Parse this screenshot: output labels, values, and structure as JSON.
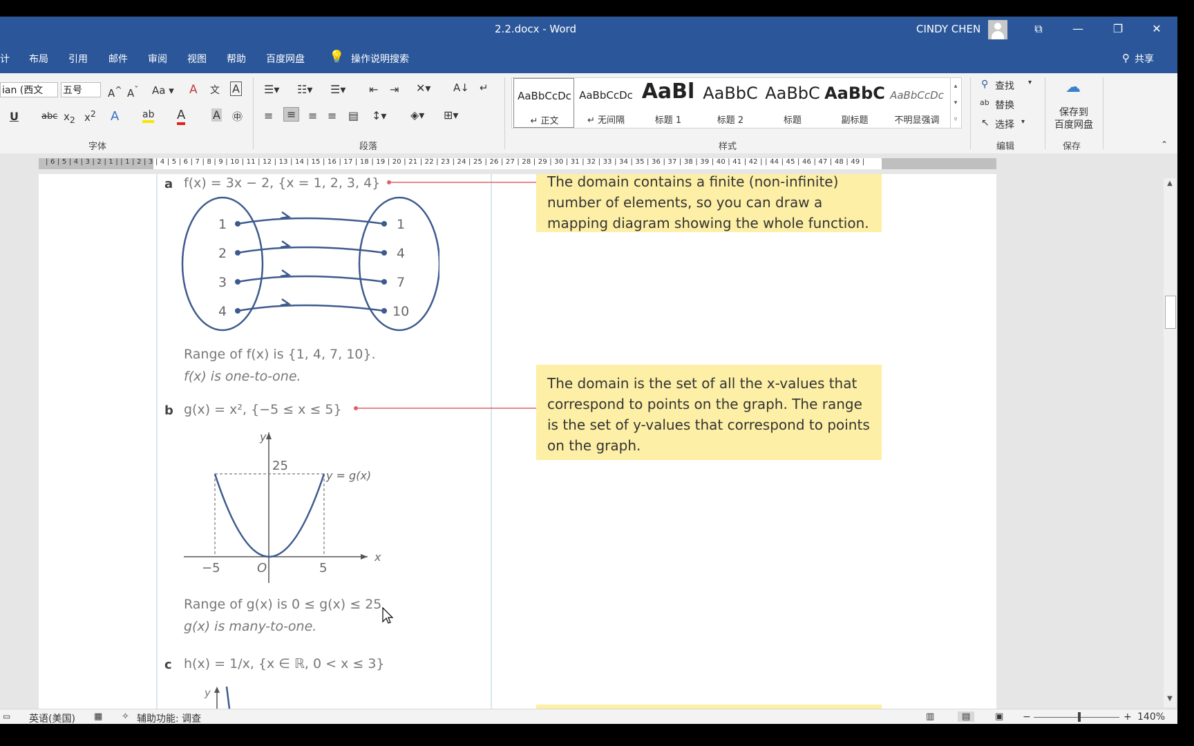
{
  "window": {
    "title": "2.2.docx  -  Word",
    "user": "CINDY CHEN",
    "buttons": [
      "⧉",
      "—",
      "❐",
      "✕"
    ]
  },
  "menu": {
    "items": [
      "计",
      "布局",
      "引用",
      "邮件",
      "审阅",
      "视图",
      "帮助",
      "百度网盘"
    ],
    "search": "操作说明搜索",
    "share": "共享"
  },
  "ribbon": {
    "font_name": "ian (西文 ",
    "font_size": "五号",
    "font_group": "字体",
    "paragraph_group": "段落",
    "styles_group": "样式",
    "edit_group": "编辑",
    "save_group": "保存",
    "styles": [
      {
        "preview": "AaBbCcDc",
        "name": "↵ 正文"
      },
      {
        "preview": "AaBbCcDc",
        "name": "↵ 无间隔"
      },
      {
        "preview": "AaBl",
        "name": "标题 1"
      },
      {
        "preview": "AaBbC",
        "name": "标题 2"
      },
      {
        "preview": "AaBbC",
        "name": "标题"
      },
      {
        "preview": "AaBbC",
        "name": "副标题"
      },
      {
        "preview": "AaBbCcDc",
        "name": "不明显强调"
      }
    ],
    "find": "查找",
    "replace": "替换",
    "select": "选择",
    "save_baidu": "保存到\n百度网盘"
  },
  "ruler": {
    "text": "| 6 | 5 | 4 | 3 | 2 | 1 |   | 1 | 2 | 3 | 4 | 5 | 6 | 7 | 8 | 9 | 10 | 11 | 12 | 13 | 14 | 15 | 16 | 17 | 18 | 19 | 20 | 21 | 22 | 23 | 24 | 25 | 26 | 27 | 28 | 29 | 30 | 31 | 32 | 33 | 34 | 35 | 36 | 37 | 38 | 39 | 40 | 41 | 42 |   | 44 | 45 | 46 | 47 | 48 | 49 |"
  },
  "document": {
    "a_label": "a",
    "a_func": "f(x) = 3x − 2, {x = 1, 2, 3, 4}",
    "mapping_left": [
      "1",
      "2",
      "3",
      "4"
    ],
    "mapping_right": [
      "1",
      "4",
      "7",
      "10"
    ],
    "a_range": "Range of f(x) is {1, 4, 7, 10}.",
    "a_type": "f(x) is one-to-one.",
    "b_label": "b",
    "b_func": "g(x) = x², {−5 ≤ x ≤ 5}",
    "graph_y": "y",
    "graph_x": "x",
    "graph_25": "25",
    "graph_m5": "−5",
    "graph_0": "O",
    "graph_5": "5",
    "graph_curve": "y = g(x)",
    "b_range": "Range of g(x) is 0 ≤ g(x) ≤ 25",
    "b_type": "g(x) is many-to-one.",
    "c_label": "c",
    "c_func": "h(x) = 1/x, {x ∈ ℝ, 0 < x ≤ 3}",
    "c_y": "y",
    "callout1": "The domain contains a finite (non-infinite) number of elements, so you can draw a mapping diagram showing the whole function.",
    "callout2": "The domain is the set of all the x-values that correspond to points on the graph. The range is the set of y-values that correspond to points on the graph."
  },
  "status": {
    "language": "英语(美国)",
    "accessibility": "辅助功能: 调查",
    "zoom": "140%"
  },
  "colors": {
    "title_bar": "#2b579a",
    "callout_bg": "#fdefa5",
    "diagram_blue": "#3d5a8c",
    "pointer_red": "#e0606a"
  }
}
